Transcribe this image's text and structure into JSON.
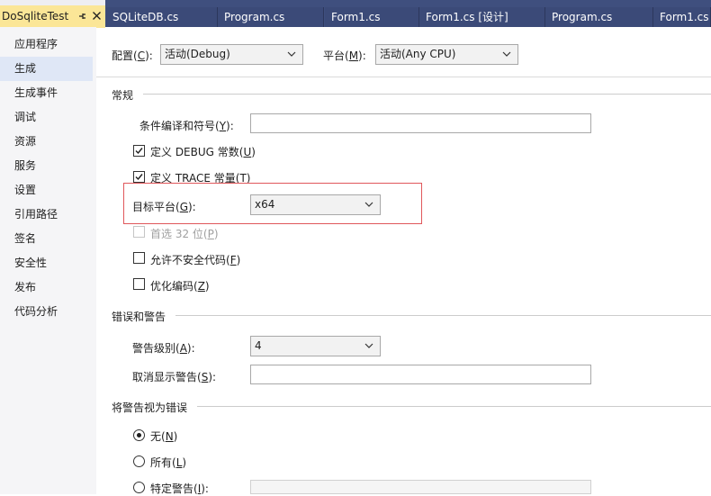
{
  "tabs": [
    {
      "label": "DoSqliteTest",
      "active": true
    },
    {
      "label": "SQLiteDB.cs"
    },
    {
      "label": "Program.cs"
    },
    {
      "label": "Form1.cs"
    },
    {
      "label": "Form1.cs [设计]"
    },
    {
      "label": "Program.cs"
    },
    {
      "label": "Form1.cs"
    }
  ],
  "sidebar": {
    "items": [
      {
        "label": "应用程序"
      },
      {
        "label": "生成",
        "selected": true
      },
      {
        "label": "生成事件"
      },
      {
        "label": "调试"
      },
      {
        "label": "资源"
      },
      {
        "label": "服务"
      },
      {
        "label": "设置"
      },
      {
        "label": "引用路径"
      },
      {
        "label": "签名"
      },
      {
        "label": "安全性"
      },
      {
        "label": "发布"
      },
      {
        "label": "代码分析"
      }
    ]
  },
  "config": {
    "configuration_label": "配置(",
    "configuration_key": "C",
    "configuration_label_end": "):",
    "configuration_value": "活动(Debug)",
    "platform_label": "平台(",
    "platform_key": "M",
    "platform_label_end": "):",
    "platform_value": "活动(Any CPU)"
  },
  "general": {
    "section_title": "常规",
    "symbols_label": "条件编译和符号(",
    "symbols_key": "Y",
    "symbols_label_end": "):",
    "symbols_value": "",
    "debug_label": "定义 DEBUG 常数(",
    "debug_key": "U",
    "debug_label_end": ")",
    "debug_checked": true,
    "trace_label": "定义 TRACE 常量(",
    "trace_key": "T",
    "trace_label_end": ")",
    "trace_checked": true,
    "target_label": "目标平台(",
    "target_key": "G",
    "target_label_end": "):",
    "target_value": "x64",
    "prefer32_label": "首选 32 位(",
    "prefer32_key": "P",
    "prefer32_label_end": ")",
    "unsafe_label": "允许不安全代码(",
    "unsafe_key": "F",
    "unsafe_label_end": ")",
    "optimize_label": "优化编码(",
    "optimize_key": "Z",
    "optimize_label_end": ")"
  },
  "errors": {
    "section_title": "错误和警告",
    "warning_level_label": "警告级别(",
    "warning_level_key": "A",
    "warning_level_label_end": "):",
    "warning_level_value": "4",
    "suppress_label": "取消显示警告(",
    "suppress_key": "S",
    "suppress_label_end": "):",
    "suppress_value": ""
  },
  "treat_warnings": {
    "section_title": "将警告视为错误",
    "none_label": "无(",
    "none_key": "N",
    "none_label_end": ")",
    "all_label": "所有(",
    "all_key": "L",
    "all_label_end": ")",
    "specific_label": "特定警告(",
    "specific_key": "I",
    "specific_label_end": "):"
  },
  "colors": {
    "tab_active": "#fbe697",
    "tab_inactive": "#3b4a78",
    "sidebar_selected": "#dfe7f6",
    "highlight_border": "#e0575b"
  },
  "icons": {
    "pin": "pin-icon",
    "close": "close-icon",
    "dropdown": "chevron-down-icon",
    "check": "checkmark-icon"
  }
}
